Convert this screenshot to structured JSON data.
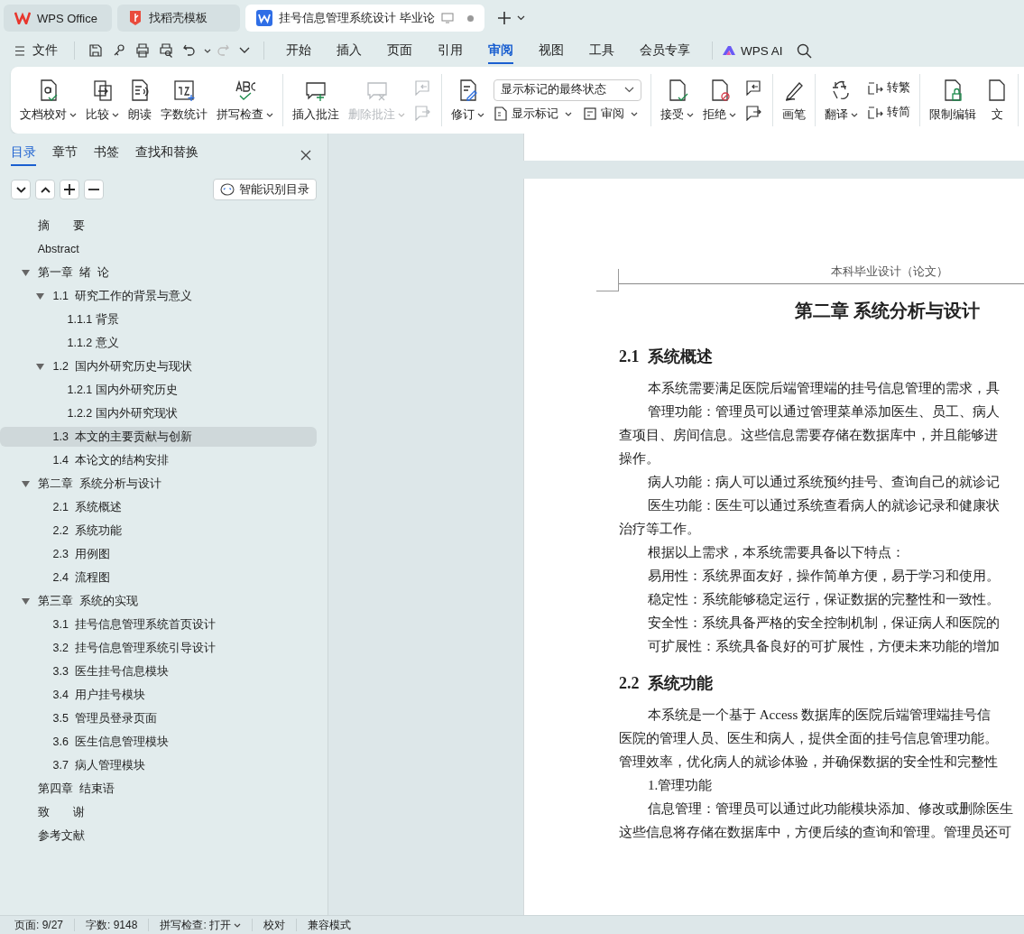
{
  "window_tabs": [
    {
      "label": "WPS Office",
      "kind": "home",
      "selected": false
    },
    {
      "label": "找稻壳模板",
      "kind": "template",
      "selected": false
    },
    {
      "label": "挂号信息管理系统设计 毕业论",
      "kind": "doc",
      "selected": true
    }
  ],
  "menu_bar": {
    "file": "文件",
    "tabs": [
      {
        "label": "开始",
        "selected": false
      },
      {
        "label": "插入",
        "selected": false
      },
      {
        "label": "页面",
        "selected": false
      },
      {
        "label": "引用",
        "selected": false
      },
      {
        "label": "审阅",
        "selected": true
      },
      {
        "label": "视图",
        "selected": false
      },
      {
        "label": "工具",
        "selected": false
      },
      {
        "label": "会员专享",
        "selected": false
      }
    ],
    "ai": "WPS AI"
  },
  "ribbon": {
    "groups": [
      {
        "items": [
          {
            "kind": "large",
            "label": "文档校对",
            "dropdown": true,
            "disabled": false
          },
          {
            "kind": "large",
            "label": "比较",
            "dropdown": true,
            "disabled": false
          },
          {
            "kind": "large",
            "label": "朗读",
            "dropdown": false,
            "disabled": false
          },
          {
            "kind": "large",
            "label": "字数统计",
            "dropdown": false,
            "disabled": false
          },
          {
            "kind": "large",
            "label": "拼写检查",
            "dropdown": true,
            "disabled": false
          }
        ]
      },
      {
        "items": [
          {
            "kind": "large",
            "label": "插入批注",
            "dropdown": false,
            "disabled": false
          },
          {
            "kind": "large",
            "label": "删除批注",
            "dropdown": true,
            "disabled": true
          },
          {
            "kind": "icon-stack",
            "disabled": true
          }
        ]
      },
      {
        "items": [
          {
            "kind": "large",
            "label": "修订",
            "dropdown": true,
            "disabled": false
          },
          {
            "kind": "select-stack",
            "value": "显示标记的最终状态",
            "buttons": [
              {
                "label": "显示标记",
                "dropdown": true
              },
              {
                "label": "审阅",
                "dropdown": true
              }
            ]
          }
        ]
      },
      {
        "items": [
          {
            "kind": "large",
            "label": "接受",
            "dropdown": true,
            "disabled": false
          },
          {
            "kind": "large",
            "label": "拒绝",
            "dropdown": true,
            "disabled": false
          },
          {
            "kind": "icon-stack",
            "disabled": false
          }
        ]
      },
      {
        "items": [
          {
            "kind": "large",
            "label": "画笔",
            "dropdown": false,
            "disabled": false
          }
        ]
      },
      {
        "items": [
          {
            "kind": "large",
            "label": "翻译",
            "dropdown": true,
            "disabled": false
          },
          {
            "kind": "button-stack",
            "buttons": [
              {
                "label": "转繁"
              },
              {
                "label": "转简"
              }
            ]
          }
        ]
      },
      {
        "items": [
          {
            "kind": "large",
            "label": "限制编辑",
            "dropdown": false,
            "disabled": false
          },
          {
            "kind": "large",
            "label": "文",
            "dropdown": false,
            "disabled": false
          }
        ]
      }
    ]
  },
  "sidebar": {
    "tabs": [
      {
        "label": "目录",
        "selected": true
      },
      {
        "label": "章节",
        "selected": false
      },
      {
        "label": "书签",
        "selected": false
      },
      {
        "label": "查找和替换",
        "selected": false
      }
    ],
    "smart_button": "智能识别目录",
    "toc": [
      {
        "label": "摘　　要",
        "selected": false
      },
      {
        "label": "Abstract",
        "selected": false
      },
      {
        "label": "第一章  绪  论",
        "selected": false,
        "expanded": true,
        "children": [
          {
            "label": "1.1  研究工作的背景与意义",
            "selected": false,
            "expanded": true,
            "children": [
              {
                "label": "1.1.1 背景",
                "selected": false
              },
              {
                "label": "1.1.2 意义",
                "selected": false
              }
            ]
          },
          {
            "label": "1.2  国内外研究历史与现状",
            "selected": false,
            "expanded": true,
            "children": [
              {
                "label": "1.2.1 国内外研究历史",
                "selected": false
              },
              {
                "label": "1.2.2 国内外研究现状",
                "selected": false
              }
            ]
          },
          {
            "label": "1.3  本文的主要贡献与创新",
            "selected": true
          },
          {
            "label": "1.4  本论文的结构安排",
            "selected": false
          }
        ]
      },
      {
        "label": "第二章  系统分析与设计",
        "selected": false,
        "expanded": true,
        "children": [
          {
            "label": "2.1  系统概述",
            "selected": false
          },
          {
            "label": "2.2  系统功能",
            "selected": false
          },
          {
            "label": "2.3  用例图",
            "selected": false
          },
          {
            "label": "2.4  流程图",
            "selected": false
          }
        ]
      },
      {
        "label": "第三章  系统的实现",
        "selected": false,
        "expanded": true,
        "children": [
          {
            "label": "3.1  挂号信息管理系统首页设计",
            "selected": false
          },
          {
            "label": "3.2  挂号信息管理系统引导设计",
            "selected": false
          },
          {
            "label": "3.3  医生挂号信息模块",
            "selected": false
          },
          {
            "label": "3.4  用户挂号模块",
            "selected": false
          },
          {
            "label": "3.5  管理员登录页面",
            "selected": false
          },
          {
            "label": "3.6  医生信息管理模块",
            "selected": false
          },
          {
            "label": "3.7  病人管理模块",
            "selected": false
          }
        ]
      },
      {
        "label": "第四章  结束语",
        "selected": false
      },
      {
        "label": "致　　谢",
        "selected": false
      },
      {
        "label": "参考文献",
        "selected": false
      }
    ]
  },
  "document": {
    "blocks": [
      {
        "kind": "header",
        "text": "本科毕业设计（论文）"
      },
      {
        "kind": "chapter",
        "text": "第二章  系统分析与设计"
      },
      {
        "kind": "heading",
        "text": "2.1  系统概述"
      },
      {
        "kind": "para",
        "lines": [
          "本系统需要满足医院后端管理端的挂号信息管理的需求，具"
        ]
      },
      {
        "kind": "para",
        "lines": [
          "管理功能：管理员可以通过管理菜单添加医生、员工、病人",
          "查项目、房间信息。这些信息需要存储在数据库中，并且能够进",
          "操作。"
        ]
      },
      {
        "kind": "para",
        "lines": [
          "病人功能：病人可以通过系统预约挂号、查询自己的就诊记"
        ]
      },
      {
        "kind": "para",
        "lines": [
          "医生功能：医生可以通过系统查看病人的就诊记录和健康状",
          "治疗等工作。"
        ]
      },
      {
        "kind": "para",
        "lines": [
          "根据以上需求，本系统需要具备以下特点："
        ]
      },
      {
        "kind": "para",
        "lines": [
          "易用性：系统界面友好，操作简单方便，易于学习和使用。"
        ]
      },
      {
        "kind": "para",
        "lines": [
          "稳定性：系统能够稳定运行，保证数据的完整性和一致性。"
        ]
      },
      {
        "kind": "para",
        "lines": [
          "安全性：系统具备严格的安全控制机制，保证病人和医院的"
        ]
      },
      {
        "kind": "para",
        "lines": [
          "可扩展性：系统具备良好的可扩展性，方便未来功能的增加"
        ]
      },
      {
        "kind": "heading",
        "text": "2.2  系统功能"
      },
      {
        "kind": "para",
        "lines": [
          "本系统是一个基于 Access 数据库的医院后端管理端挂号信",
          "医院的管理人员、医生和病人，提供全面的挂号信息管理功能。",
          "管理效率，优化病人的就诊体验，并确保数据的安全性和完整性"
        ]
      },
      {
        "kind": "para",
        "lines": [
          "1.管理功能"
        ]
      },
      {
        "kind": "para",
        "lines": [
          "信息管理：管理员可以通过此功能模块添加、修改或删除医生",
          "这些信息将存储在数据库中，方便后续的查询和管理。管理员还可"
        ]
      }
    ]
  },
  "status_bar": [
    {
      "label": "页面: 9/27",
      "dropdown": false
    },
    {
      "label": "字数: 9148",
      "dropdown": false
    },
    {
      "label": "拼写检查: 打开",
      "dropdown": true
    },
    {
      "label": "校对",
      "dropdown": false
    },
    {
      "label": "兼容模式",
      "dropdown": false
    }
  ]
}
